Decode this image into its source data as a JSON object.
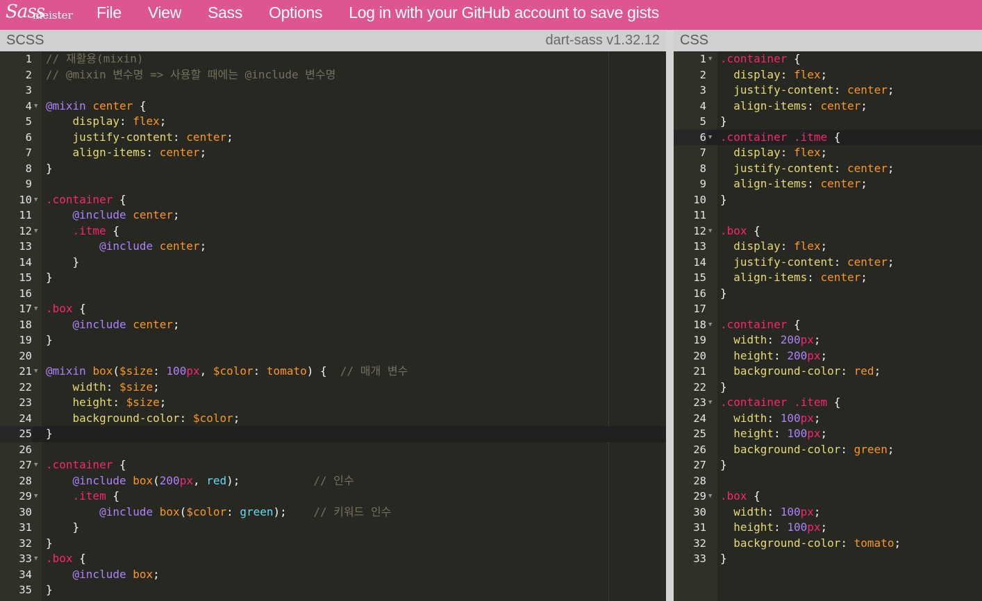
{
  "app": {
    "logo_text": "Sass",
    "logo_sub": "meister"
  },
  "menu": [
    "File",
    "View",
    "Sass",
    "Options",
    "Log in with your GitHub account to save gists"
  ],
  "scss_panel": {
    "title": "SCSS",
    "version": "dart-sass v1.32.12",
    "active_line": 25,
    "lines": [
      [
        [
          "c",
          "// 재활용(mixin)"
        ]
      ],
      [
        [
          "c",
          "// @mixin 변수명 => 사용할 때에는 @include 변수명"
        ]
      ],
      [],
      [
        [
          "at",
          "@mixin "
        ],
        [
          "fn",
          "center"
        ],
        [
          "pun",
          " {"
        ]
      ],
      [
        [
          "pun",
          "    "
        ],
        [
          "prop",
          "display"
        ],
        [
          "pun",
          ": "
        ],
        [
          "val",
          "flex"
        ],
        [
          "pun",
          ";"
        ]
      ],
      [
        [
          "pun",
          "    "
        ],
        [
          "prop",
          "justify-content"
        ],
        [
          "pun",
          ": "
        ],
        [
          "val",
          "center"
        ],
        [
          "pun",
          ";"
        ]
      ],
      [
        [
          "pun",
          "    "
        ],
        [
          "prop",
          "align-items"
        ],
        [
          "pun",
          ": "
        ],
        [
          "val",
          "center"
        ],
        [
          "pun",
          ";"
        ]
      ],
      [
        [
          "pun",
          "}"
        ]
      ],
      [],
      [
        [
          "sel",
          ".container"
        ],
        [
          "pun",
          " {"
        ]
      ],
      [
        [
          "pun",
          "    "
        ],
        [
          "at",
          "@include "
        ],
        [
          "fn",
          "center"
        ],
        [
          "pun",
          ";"
        ]
      ],
      [
        [
          "pun",
          "    "
        ],
        [
          "sel",
          ".itme"
        ],
        [
          "pun",
          " {"
        ]
      ],
      [
        [
          "pun",
          "        "
        ],
        [
          "at",
          "@include "
        ],
        [
          "fn",
          "center"
        ],
        [
          "pun",
          ";"
        ]
      ],
      [
        [
          "pun",
          "    }"
        ]
      ],
      [
        [
          "pun",
          "}"
        ]
      ],
      [],
      [
        [
          "sel",
          ".box"
        ],
        [
          "pun",
          " {"
        ]
      ],
      [
        [
          "pun",
          "    "
        ],
        [
          "at",
          "@include "
        ],
        [
          "fn",
          "center"
        ],
        [
          "pun",
          ";"
        ]
      ],
      [
        [
          "pun",
          "}"
        ]
      ],
      [],
      [
        [
          "at",
          "@mixin "
        ],
        [
          "fn",
          "box"
        ],
        [
          "pun",
          "("
        ],
        [
          "var",
          "$size"
        ],
        [
          "pun",
          ": "
        ],
        [
          "num-lit",
          "100"
        ],
        [
          "unit",
          "px"
        ],
        [
          "pun",
          ", "
        ],
        [
          "var",
          "$color"
        ],
        [
          "pun",
          ": "
        ],
        [
          "val",
          "tomato"
        ],
        [
          "pun",
          ") {  "
        ],
        [
          "c",
          "// 매개 변수"
        ]
      ],
      [
        [
          "pun",
          "    "
        ],
        [
          "prop",
          "width"
        ],
        [
          "pun",
          ": "
        ],
        [
          "var",
          "$size"
        ],
        [
          "pun",
          ";"
        ]
      ],
      [
        [
          "pun",
          "    "
        ],
        [
          "prop",
          "height"
        ],
        [
          "pun",
          ": "
        ],
        [
          "var",
          "$size"
        ],
        [
          "pun",
          ";"
        ]
      ],
      [
        [
          "pun",
          "    "
        ],
        [
          "prop",
          "background-color"
        ],
        [
          "pun",
          ": "
        ],
        [
          "var",
          "$color"
        ],
        [
          "pun",
          ";"
        ]
      ],
      [
        [
          "pun",
          "}"
        ]
      ],
      [],
      [
        [
          "sel",
          ".container"
        ],
        [
          "pun",
          " {"
        ]
      ],
      [
        [
          "pun",
          "    "
        ],
        [
          "at",
          "@include "
        ],
        [
          "fn",
          "box"
        ],
        [
          "pun",
          "("
        ],
        [
          "num-lit",
          "200"
        ],
        [
          "unit",
          "px"
        ],
        [
          "pun",
          ", "
        ],
        [
          "kw2",
          "red"
        ],
        [
          "pun",
          ");           "
        ],
        [
          "c",
          "// 인수"
        ]
      ],
      [
        [
          "pun",
          "    "
        ],
        [
          "sel",
          ".item"
        ],
        [
          "pun",
          " {"
        ]
      ],
      [
        [
          "pun",
          "        "
        ],
        [
          "at",
          "@include "
        ],
        [
          "fn",
          "box"
        ],
        [
          "pun",
          "("
        ],
        [
          "var",
          "$color"
        ],
        [
          "pun",
          ": "
        ],
        [
          "kw2",
          "green"
        ],
        [
          "pun",
          ");    "
        ],
        [
          "c",
          "// 키워드 인수"
        ]
      ],
      [
        [
          "pun",
          "    }"
        ]
      ],
      [
        [
          "pun",
          "}"
        ]
      ],
      [
        [
          "sel",
          ".box"
        ],
        [
          "pun",
          " {"
        ]
      ],
      [
        [
          "pun",
          "    "
        ],
        [
          "at",
          "@include "
        ],
        [
          "fn",
          "box"
        ],
        [
          "pun",
          ";"
        ]
      ],
      [
        [
          "pun",
          "}"
        ]
      ]
    ],
    "folds": [
      4,
      10,
      12,
      17,
      21,
      27,
      29,
      33
    ]
  },
  "css_panel": {
    "title": "CSS",
    "active_line": 6,
    "lines": [
      [
        [
          "sel",
          ".container"
        ],
        [
          "pun",
          " {"
        ]
      ],
      [
        [
          "pun",
          "  "
        ],
        [
          "prop",
          "display"
        ],
        [
          "pun",
          ": "
        ],
        [
          "val",
          "flex"
        ],
        [
          "pun",
          ";"
        ]
      ],
      [
        [
          "pun",
          "  "
        ],
        [
          "prop",
          "justify-content"
        ],
        [
          "pun",
          ": "
        ],
        [
          "val",
          "center"
        ],
        [
          "pun",
          ";"
        ]
      ],
      [
        [
          "pun",
          "  "
        ],
        [
          "prop",
          "align-items"
        ],
        [
          "pun",
          ": "
        ],
        [
          "val",
          "center"
        ],
        [
          "pun",
          ";"
        ]
      ],
      [
        [
          "pun",
          "}"
        ]
      ],
      [
        [
          "sel",
          ".container .itme"
        ],
        [
          "pun",
          " {"
        ]
      ],
      [
        [
          "pun",
          "  "
        ],
        [
          "prop",
          "display"
        ],
        [
          "pun",
          ": "
        ],
        [
          "val",
          "flex"
        ],
        [
          "pun",
          ";"
        ]
      ],
      [
        [
          "pun",
          "  "
        ],
        [
          "prop",
          "justify-content"
        ],
        [
          "pun",
          ": "
        ],
        [
          "val",
          "center"
        ],
        [
          "pun",
          ";"
        ]
      ],
      [
        [
          "pun",
          "  "
        ],
        [
          "prop",
          "align-items"
        ],
        [
          "pun",
          ": "
        ],
        [
          "val",
          "center"
        ],
        [
          "pun",
          ";"
        ]
      ],
      [
        [
          "pun",
          "}"
        ]
      ],
      [],
      [
        [
          "sel",
          ".box"
        ],
        [
          "pun",
          " {"
        ]
      ],
      [
        [
          "pun",
          "  "
        ],
        [
          "prop",
          "display"
        ],
        [
          "pun",
          ": "
        ],
        [
          "val",
          "flex"
        ],
        [
          "pun",
          ";"
        ]
      ],
      [
        [
          "pun",
          "  "
        ],
        [
          "prop",
          "justify-content"
        ],
        [
          "pun",
          ": "
        ],
        [
          "val",
          "center"
        ],
        [
          "pun",
          ";"
        ]
      ],
      [
        [
          "pun",
          "  "
        ],
        [
          "prop",
          "align-items"
        ],
        [
          "pun",
          ": "
        ],
        [
          "val",
          "center"
        ],
        [
          "pun",
          ";"
        ]
      ],
      [
        [
          "pun",
          "}"
        ]
      ],
      [],
      [
        [
          "sel",
          ".container"
        ],
        [
          "pun",
          " {"
        ]
      ],
      [
        [
          "pun",
          "  "
        ],
        [
          "prop",
          "width"
        ],
        [
          "pun",
          ": "
        ],
        [
          "num-lit",
          "200"
        ],
        [
          "unit",
          "px"
        ],
        [
          "pun",
          ";"
        ]
      ],
      [
        [
          "pun",
          "  "
        ],
        [
          "prop",
          "height"
        ],
        [
          "pun",
          ": "
        ],
        [
          "num-lit",
          "200"
        ],
        [
          "unit",
          "px"
        ],
        [
          "pun",
          ";"
        ]
      ],
      [
        [
          "pun",
          "  "
        ],
        [
          "prop",
          "background-color"
        ],
        [
          "pun",
          ": "
        ],
        [
          "val",
          "red"
        ],
        [
          "pun",
          ";"
        ]
      ],
      [
        [
          "pun",
          "}"
        ]
      ],
      [
        [
          "sel",
          ".container .item"
        ],
        [
          "pun",
          " {"
        ]
      ],
      [
        [
          "pun",
          "  "
        ],
        [
          "prop",
          "width"
        ],
        [
          "pun",
          ": "
        ],
        [
          "num-lit",
          "100"
        ],
        [
          "unit",
          "px"
        ],
        [
          "pun",
          ";"
        ]
      ],
      [
        [
          "pun",
          "  "
        ],
        [
          "prop",
          "height"
        ],
        [
          "pun",
          ": "
        ],
        [
          "num-lit",
          "100"
        ],
        [
          "unit",
          "px"
        ],
        [
          "pun",
          ";"
        ]
      ],
      [
        [
          "pun",
          "  "
        ],
        [
          "prop",
          "background-color"
        ],
        [
          "pun",
          ": "
        ],
        [
          "val",
          "green"
        ],
        [
          "pun",
          ";"
        ]
      ],
      [
        [
          "pun",
          "}"
        ]
      ],
      [],
      [
        [
          "sel",
          ".box"
        ],
        [
          "pun",
          " {"
        ]
      ],
      [
        [
          "pun",
          "  "
        ],
        [
          "prop",
          "width"
        ],
        [
          "pun",
          ": "
        ],
        [
          "num-lit",
          "100"
        ],
        [
          "unit",
          "px"
        ],
        [
          "pun",
          ";"
        ]
      ],
      [
        [
          "pun",
          "  "
        ],
        [
          "prop",
          "height"
        ],
        [
          "pun",
          ": "
        ],
        [
          "num-lit",
          "100"
        ],
        [
          "unit",
          "px"
        ],
        [
          "pun",
          ";"
        ]
      ],
      [
        [
          "pun",
          "  "
        ],
        [
          "prop",
          "background-color"
        ],
        [
          "pun",
          ": "
        ],
        [
          "val",
          "tomato"
        ],
        [
          "pun",
          ";"
        ]
      ],
      [
        [
          "pun",
          "}"
        ]
      ]
    ],
    "folds": [
      1,
      6,
      12,
      18,
      23,
      29
    ]
  },
  "colors": {
    "topbar": "#dd5591",
    "editor_bg": "#272822",
    "gutter_bg": "#2f3129"
  }
}
